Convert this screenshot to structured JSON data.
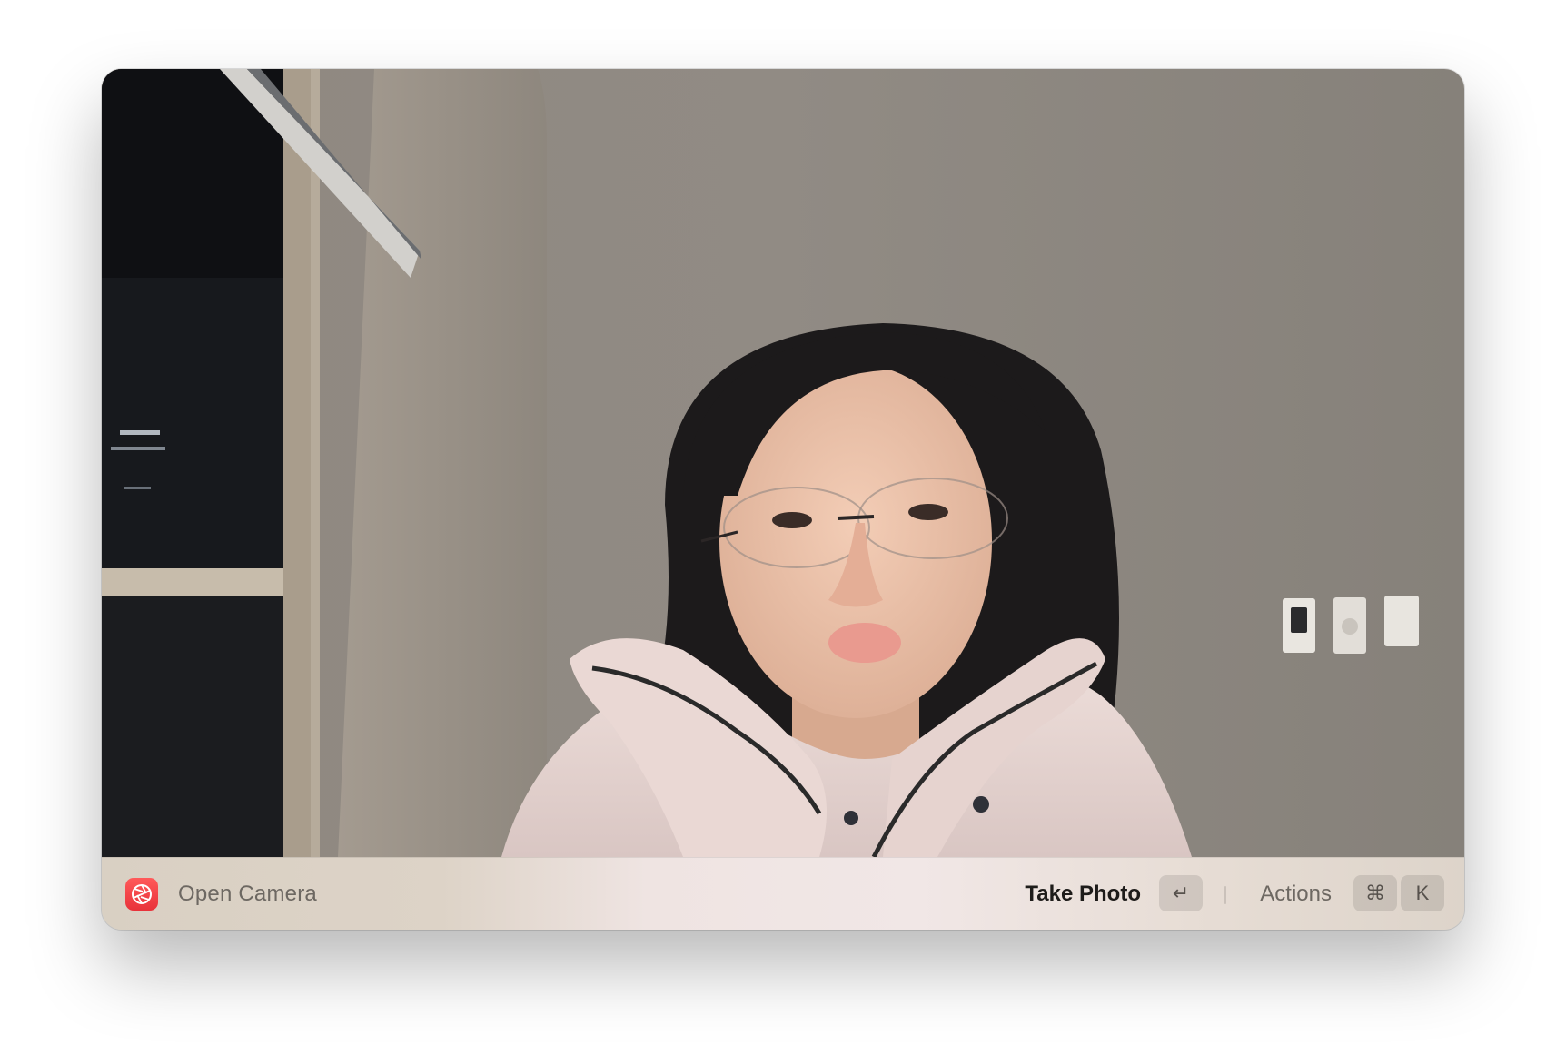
{
  "window": {
    "app_icon": "camera-aperture-icon",
    "accent_color": "#e8323a"
  },
  "footer": {
    "command_title": "Open Camera",
    "primary_action_label": "Take Photo",
    "primary_action_shortcut": "↵",
    "actions_label": "Actions",
    "actions_shortcut_modifier": "⌘",
    "actions_shortcut_key": "K"
  }
}
